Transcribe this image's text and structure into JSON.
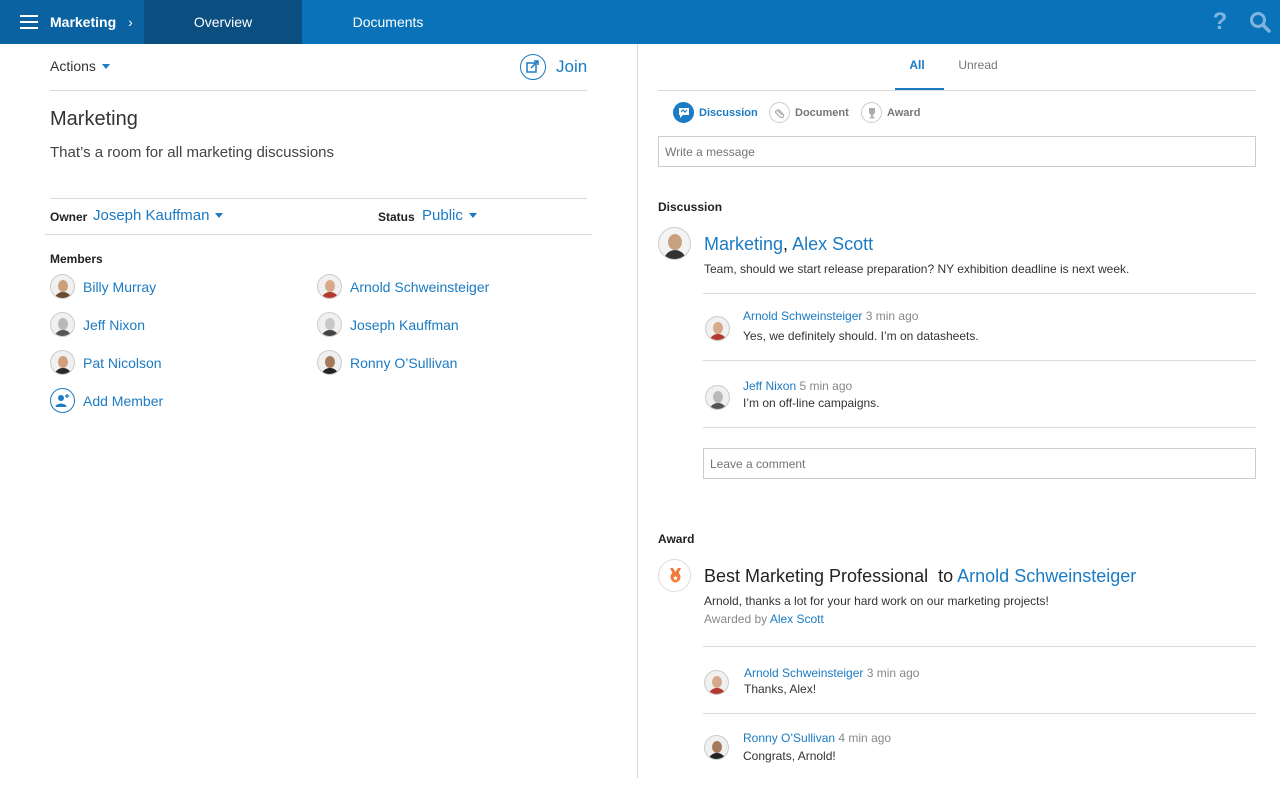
{
  "topbar": {
    "room": "Marketing",
    "tabs": [
      {
        "label": "Overview"
      },
      {
        "label": "Documents"
      }
    ],
    "help_glyph": "?"
  },
  "left": {
    "actions_label": "Actions",
    "join_label": "Join",
    "room_title": "Marketing",
    "room_description": "That’s a room for all marketing discussions",
    "owner_label": "Owner",
    "owner_value": "Joseph Kauffman",
    "status_label": "Status",
    "status_value": "Public",
    "members_title": "Members",
    "members": [
      {
        "name": "Billy Murray"
      },
      {
        "name": "Arnold Schweinsteiger"
      },
      {
        "name": "Jeff Nixon"
      },
      {
        "name": "Joseph Kauffman"
      },
      {
        "name": "Pat Nicolson"
      },
      {
        "name": "Ronny O’Sullivan"
      }
    ],
    "add_member_label": "Add Member"
  },
  "right": {
    "tabs": [
      {
        "label": "All"
      },
      {
        "label": "Unread"
      }
    ],
    "post_types": [
      {
        "label": "Discussion"
      },
      {
        "label": "Document"
      },
      {
        "label": "Award"
      }
    ],
    "message_placeholder": "Write a message",
    "discussion": {
      "section_title": "Discussion",
      "head_room": "Marketing",
      "head_sep": ",",
      "head_author": "Alex Scott",
      "body": "Team, should we start release preparation? NY exhibition deadline is next week.",
      "comments": [
        {
          "author": "Arnold Schweinsteiger",
          "time": "3 min ago",
          "text": "Yes, we definitely should.  I’m on datasheets."
        },
        {
          "author": "Jeff Nixon",
          "time": "5 min ago",
          "text": "I’m on off-line campaigns."
        }
      ],
      "comment_placeholder": "Leave a comment"
    },
    "award": {
      "section_title": "Award",
      "award_name": "Best Marketing Professional",
      "to_word": "to",
      "recipient": "Arnold Schweinsteiger",
      "body": "Arnold, thanks a lot for your hard work on our marketing projects!",
      "awarded_by_label": "Awarded by",
      "awarded_by": "Alex Scott",
      "comments": [
        {
          "author": "Arnold Schweinsteiger",
          "time": "3 min ago",
          "text": "Thanks, Alex!"
        },
        {
          "author": "Ronny O’Sullivan",
          "time": "4 min ago",
          "text": "Congrats, Arnold!"
        }
      ]
    }
  },
  "colors": {
    "topbar": "#0a72b8",
    "topbar_room": "#0a63a0",
    "topbar_active_tab": "#0b4f80",
    "link": "#1b7bc3",
    "award_icon": "#f07a3a"
  },
  "icons": {
    "menu": "hamburger-icon",
    "chevron": "chevron-right-icon",
    "help": "help-icon",
    "search": "search-icon",
    "join": "join-icon",
    "add_member": "add-user-icon",
    "discussion": "discussion-icon",
    "document": "paperclip-icon",
    "award": "trophy-icon"
  }
}
